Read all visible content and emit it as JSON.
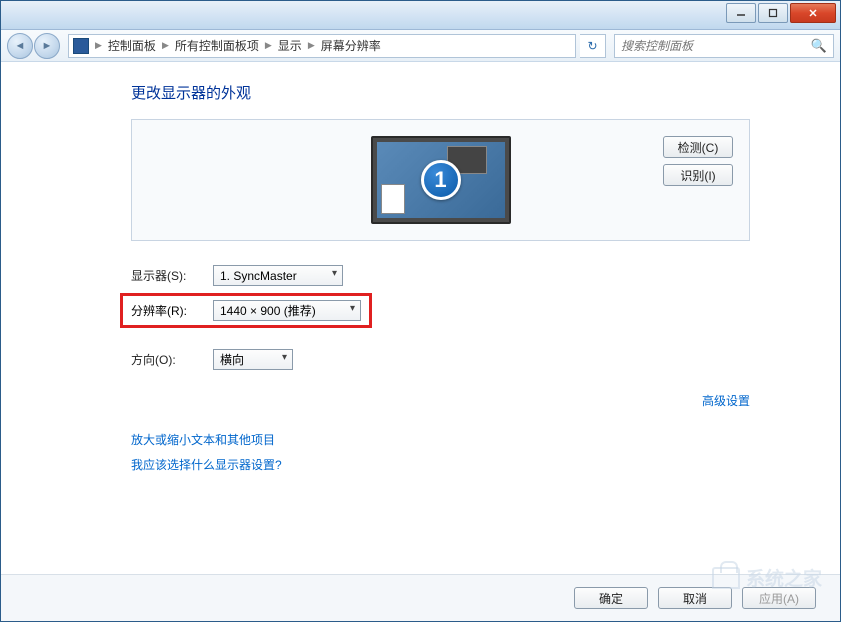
{
  "titlebar": {
    "minimize": "minimize",
    "maximize": "maximize",
    "close": "close"
  },
  "breadcrumb": {
    "items": [
      "控制面板",
      "所有控制面板项",
      "显示",
      "屏幕分辨率"
    ]
  },
  "search": {
    "placeholder": "搜索控制面板"
  },
  "page": {
    "title": "更改显示器的外观"
  },
  "preview": {
    "monitor_number": "1",
    "detect_btn": "检测(C)",
    "identify_btn": "识别(I)"
  },
  "form": {
    "display_label": "显示器(S):",
    "display_value": "1. SyncMaster",
    "resolution_label": "分辨率(R):",
    "resolution_value": "1440 × 900 (推荐)",
    "orientation_label": "方向(O):",
    "orientation_value": "横向"
  },
  "advanced_link": "高级设置",
  "links": {
    "resize_text": "放大或缩小文本和其他项目",
    "which_display": "我应该选择什么显示器设置?"
  },
  "footer": {
    "ok": "确定",
    "cancel": "取消",
    "apply": "应用(A)"
  },
  "watermark": "系统之家"
}
